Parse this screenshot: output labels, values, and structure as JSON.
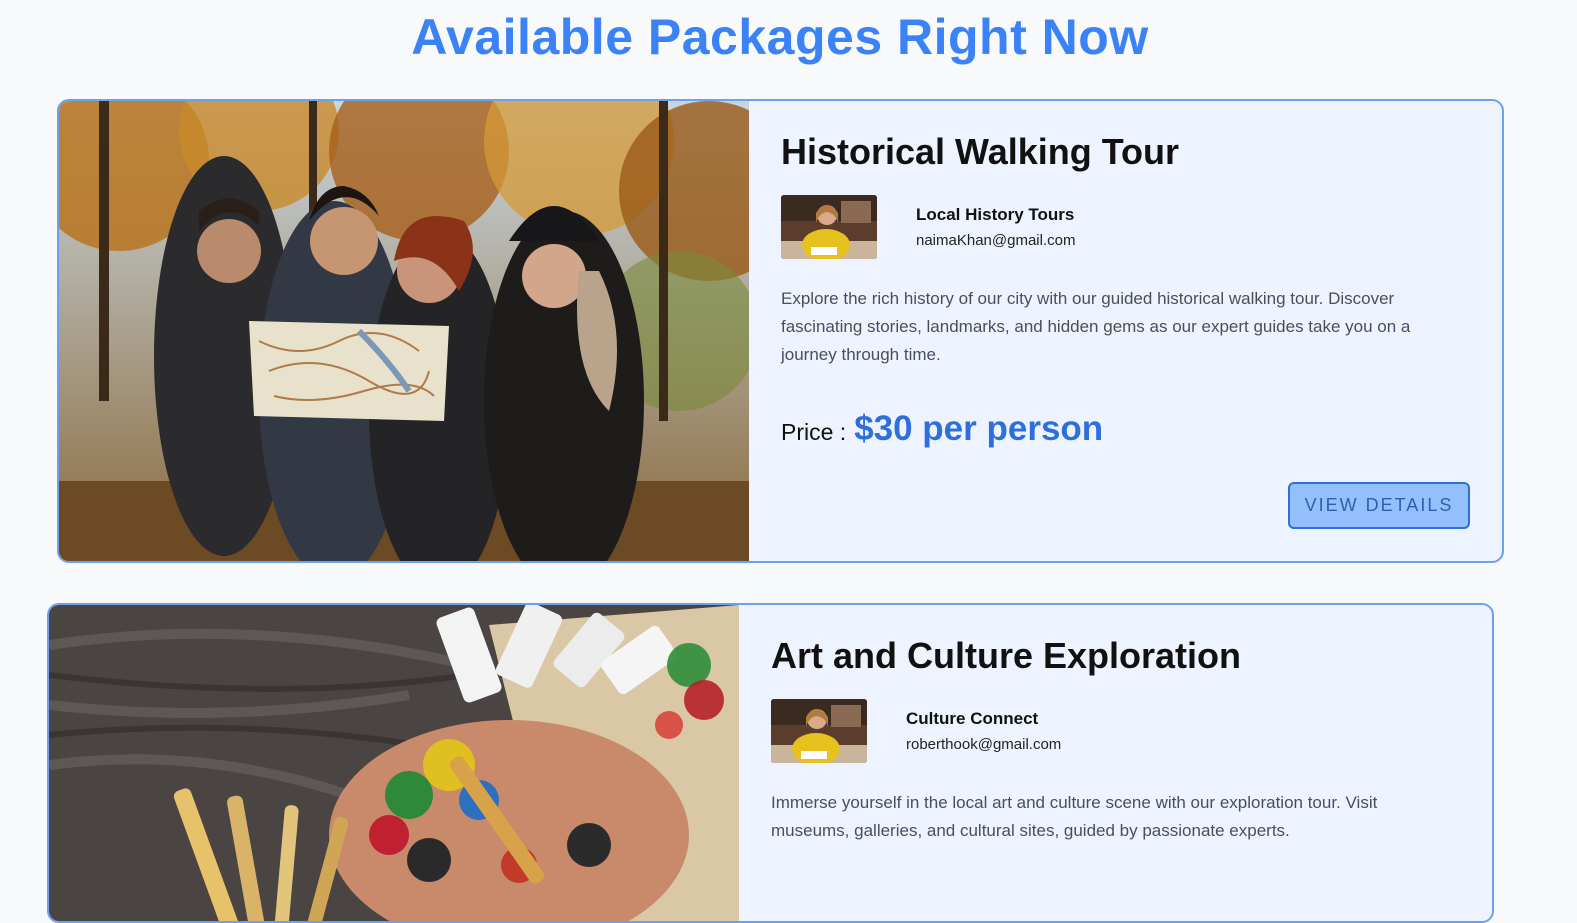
{
  "page": {
    "title": "Available Packages Right Now"
  },
  "packages": [
    {
      "title": "Historical Walking Tour",
      "host_name": "Local History Tours",
      "host_email": "naimaKhan@gmail.com",
      "description": "Explore the rich history of our city with our guided historical walking tour. Discover fascinating stories, landmarks, and hidden gems as our expert guides take you on a journey through time.",
      "price_label": "Price :",
      "price_value": "$30 per person",
      "button_label": "VIEW DETAILS",
      "image": "friends-reading-map-photo",
      "avatar": "host-photo"
    },
    {
      "title": "Art and Culture Exploration",
      "host_name": "Culture Connect",
      "host_email": "roberthook@gmail.com",
      "description": "Immerse yourself in the local art and culture scene with our exploration tour. Visit museums, galleries, and cultural sites, guided by passionate experts.",
      "image": "paint-palette-brushes-photo",
      "avatar": "host-photo"
    }
  ],
  "colors": {
    "title": "#3b82f6",
    "card_border": "#6aa2ef",
    "card_bg": "#eef4ff",
    "price": "#2f6fdc",
    "button_bg": "#93c0fb"
  }
}
